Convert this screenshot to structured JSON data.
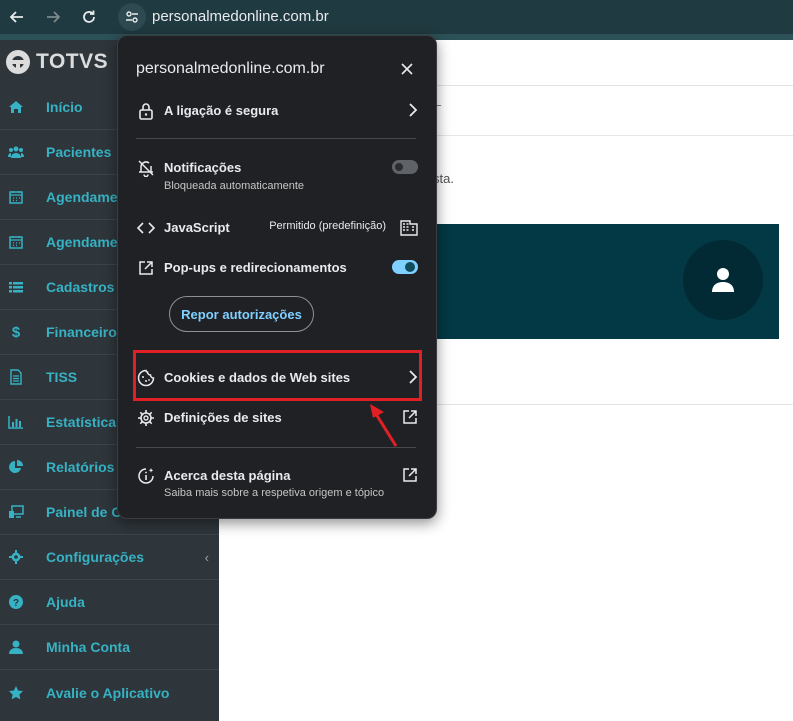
{
  "browser": {
    "url": "personalmedonline.com.br"
  },
  "sidebar": {
    "logo": "TOTVS",
    "items": [
      {
        "label": "Início",
        "icon": "home-icon"
      },
      {
        "label": "Pacientes",
        "icon": "users-icon"
      },
      {
        "label": "Agendame",
        "icon": "calendar-icon"
      },
      {
        "label": "Agendame",
        "icon": "calendar-icon"
      },
      {
        "label": "Cadastros",
        "icon": "list-icon"
      },
      {
        "label": "Financeiro",
        "icon": "dollar-icon"
      },
      {
        "label": "TISS",
        "icon": "document-icon"
      },
      {
        "label": "Estatísticas",
        "icon": "bar-chart-icon"
      },
      {
        "label": "Relatórios",
        "icon": "pie-chart-icon"
      },
      {
        "label": "Painel de C",
        "icon": "monitor-icon"
      },
      {
        "label": "Configurações",
        "icon": "gear-icon",
        "chevron": "‹"
      },
      {
        "label": "Ajuda",
        "icon": "help-icon"
      },
      {
        "label": "Minha Conta",
        "icon": "user-icon"
      },
      {
        "label": "Avalie o Aplicativo",
        "icon": "star-icon"
      }
    ]
  },
  "main": {
    "note": "sta."
  },
  "popup": {
    "title": "personalmedonline.com.br",
    "secure": "A ligação é segura",
    "notifications": {
      "label": "Notificações",
      "sub": "Bloqueada automaticamente",
      "enabled": false
    },
    "javascript": {
      "label": "JavaScript",
      "value": "Permitido (predefinição)"
    },
    "popups": {
      "label": "Pop-ups e redirecionamentos",
      "enabled": true
    },
    "reset_button": "Repor autorizações",
    "cookies": "Cookies e dados de Web sites",
    "site_settings": "Definições de sites",
    "about": {
      "label": "Acerca desta página",
      "sub": "Saiba mais sobre a respetiva origem e tópico"
    }
  },
  "colors": {
    "toolbar": "#1f3a40",
    "sidebar": "#2e363b",
    "sidebar_text": "#36b2c4",
    "popup_bg": "#202124",
    "accent": "#7fcfff",
    "banner": "#033845",
    "annotation": "#e02025"
  }
}
